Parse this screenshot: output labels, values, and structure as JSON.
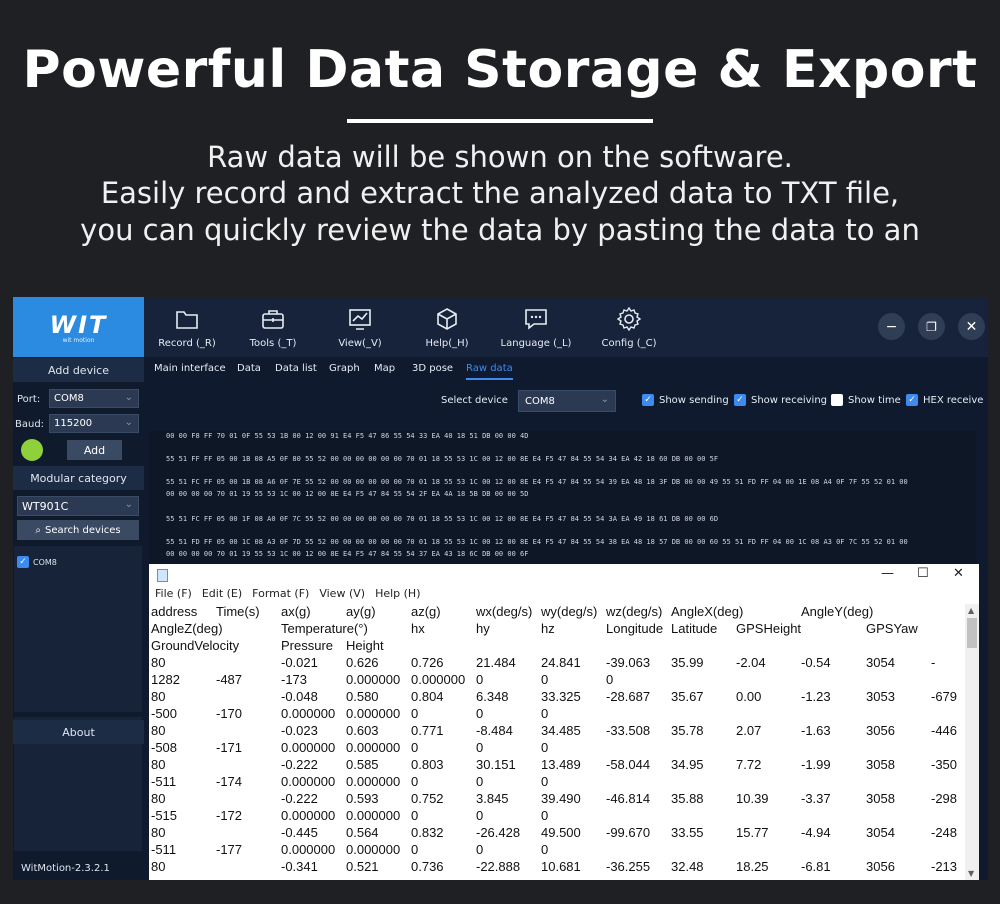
{
  "hero": {
    "title": "Powerful Data Storage & Export",
    "lines": [
      "Raw data will be shown on the software.",
      "Easily record and extract the analyzed data to TXT file,",
      "you can quickly review the data by pasting the data to an"
    ]
  },
  "app": {
    "logo": "WIT",
    "logo_small": "wit motion",
    "toolbar": [
      {
        "label": "Record (_R)",
        "icon": "folder-icon"
      },
      {
        "label": "Tools (_T)",
        "icon": "toolbox-icon"
      },
      {
        "label": "View(_V)",
        "icon": "chart-icon"
      },
      {
        "label": "Help(_H)",
        "icon": "cube-icon"
      },
      {
        "label": "Language (_L)",
        "icon": "chat-icon"
      },
      {
        "label": "Config (_C)",
        "icon": "gear-icon"
      }
    ],
    "window_controls": {
      "minimize": "−",
      "restore": "❐",
      "close": "✕"
    },
    "sidebar": {
      "add_device": "Add device",
      "port_label": "Port:",
      "port_value": "COM8",
      "baud_label": "Baud:",
      "baud_value": "115200",
      "add_button": "Add",
      "modular_category": "Modular category",
      "module_value": "WT901C",
      "search_devices": "Search devices",
      "device_item": "COM8",
      "about": "About",
      "version": "WitMotion-2.3.2.1"
    },
    "tabs": [
      "Main interface",
      "Data",
      "Data list",
      "Graph",
      "Map",
      "3D pose",
      "Raw data"
    ],
    "options": {
      "select_device_label": "Select device",
      "select_device_value": "COM8",
      "show_sending": "Show sending",
      "show_receiving": "Show receiving",
      "show_time": "Show time",
      "hex_receive": "HEX receive"
    },
    "raw_lines": [
      "00 00 F8 FF 70 01 0F 55 53 1B 00 12 00 91 E4 F5 47 86 55 54 33 EA 40 18 51 DB 00 00 4D",
      "55 51 FF FF 05 00 1B 08 A5 0F 80 55 52 00 00 00 00 00 00 70 01 18 55 53 1C 00 12 00 8E E4 F5 47 84 55 54 34 EA 42 18 60 DB 00 00 5F",
      "55 51 FC FF 05 00 1B 08 A6 0F 7E 55 52 00 00 00 00 00 00 70 01 18 55 53 1C 00 12 00 8E E4 F5 47 84 55 54 39 EA 48 18 3F DB 00 00 49 55 51 FD FF 04 00 1E 08 A4 0F 7F 55 52 01 00",
      "00 00 00 00 70 01 19 55 53 1C 00 12 00 8E E4 F5 47 84 55 54 2F EA 4A 18 5B DB 00 00 5D",
      "55 51 FC FF 05 00 1F 08 A0 0F 7C 55 52 00 00 00 00 00 00 70 01 18 55 53 1C 00 12 00 8E E4 F5 47 84 55 54 3A EA 49 18 61 DB 00 00 6D",
      "55 51 FD FF 05 00 1C 08 A3 0F 7D 55 52 00 00 00 00 00 00 70 01 18 55 53 1C 00 12 00 8E E4 F5 47 84 55 54 38 EA 48 18 57 DB 00 00 60 55 51 FD FF 04 00 1C 08 A3 0F 7C 55 52 01 00",
      "00 00 00 00 70 01 19 55 53 1C 00 12 00 8E E4 F5 47 84 55 54 37 EA 43 18 6C DB 00 00 6F"
    ]
  },
  "notepad": {
    "controls": {
      "minimize": "—",
      "maximize": "☐",
      "close": "✕"
    },
    "menu": [
      "File (F)",
      "Edit (E)",
      "Format (F)",
      "View (V)",
      "Help (H)"
    ],
    "rows": [
      [
        "address",
        "Time(s)",
        "ax(g)",
        "ay(g)",
        "az(g)",
        "wx(deg/s)",
        "wy(deg/s)",
        "wz(deg/s)",
        "AngleX(deg)",
        "",
        "AngleY(deg)",
        "",
        ""
      ],
      [
        "AngleZ(deg)",
        "",
        "Temperature(°)",
        "",
        "hx",
        "hy",
        "hz",
        "Longitude",
        "Latitude",
        "GPSHeight",
        "",
        "GPSYaw",
        ""
      ],
      [
        "GroundVelocity",
        "",
        "Pressure",
        "Height",
        "",
        "",
        "",
        "",
        "",
        "",
        "",
        "",
        ""
      ],
      [
        "80",
        "",
        "-0.021",
        "0.626",
        "0.726",
        "21.484",
        "24.841",
        "-39.063",
        "35.99",
        "-2.04",
        "-0.54",
        "3054",
        "-"
      ],
      [
        "1282",
        "-487",
        "-173",
        "0.000000",
        "0.000000",
        "0",
        "0",
        "0",
        "",
        "",
        "",
        "",
        ""
      ],
      [
        "80",
        "",
        "-0.048",
        "0.580",
        "0.804",
        "6.348",
        "33.325",
        "-28.687",
        "35.67",
        "0.00",
        "-1.23",
        "3053",
        "-679"
      ],
      [
        "-500",
        "-170",
        "0.000000",
        "0.000000",
        "0",
        "0",
        "0",
        "",
        "",
        "",
        "",
        "",
        ""
      ],
      [
        "80",
        "",
        "-0.023",
        "0.603",
        "0.771",
        "-8.484",
        "34.485",
        "-33.508",
        "35.78",
        "2.07",
        "-1.63",
        "3056",
        "-446"
      ],
      [
        "-508",
        "-171",
        "0.000000",
        "0.000000",
        "0",
        "0",
        "0",
        "",
        "",
        "",
        "",
        "",
        ""
      ],
      [
        "80",
        "",
        "-0.222",
        "0.585",
        "0.803",
        "30.151",
        "13.489",
        "-58.044",
        "34.95",
        "7.72",
        "-1.99",
        "3058",
        "-350"
      ],
      [
        "-511",
        "-174",
        "0.000000",
        "0.000000",
        "0",
        "0",
        "0",
        "",
        "",
        "",
        "",
        "",
        ""
      ],
      [
        "80",
        "",
        "-0.222",
        "0.593",
        "0.752",
        "3.845",
        "39.490",
        "-46.814",
        "35.88",
        "10.39",
        "-3.37",
        "3058",
        "-298"
      ],
      [
        "-515",
        "-172",
        "0.000000",
        "0.000000",
        "0",
        "0",
        "0",
        "",
        "",
        "",
        "",
        "",
        ""
      ],
      [
        "80",
        "",
        "-0.445",
        "0.564",
        "0.832",
        "-26.428",
        "49.500",
        "-99.670",
        "33.55",
        "15.77",
        "-4.94",
        "3054",
        "-248"
      ],
      [
        "-511",
        "-177",
        "0.000000",
        "0.000000",
        "0",
        "0",
        "0",
        "",
        "",
        "",
        "",
        "",
        ""
      ],
      [
        "80",
        "",
        "-0.341",
        "0.521",
        "0.736",
        "-22.888",
        "10.681",
        "-36.255",
        "32.48",
        "18.25",
        "-6.81",
        "3056",
        "-213"
      ]
    ]
  }
}
